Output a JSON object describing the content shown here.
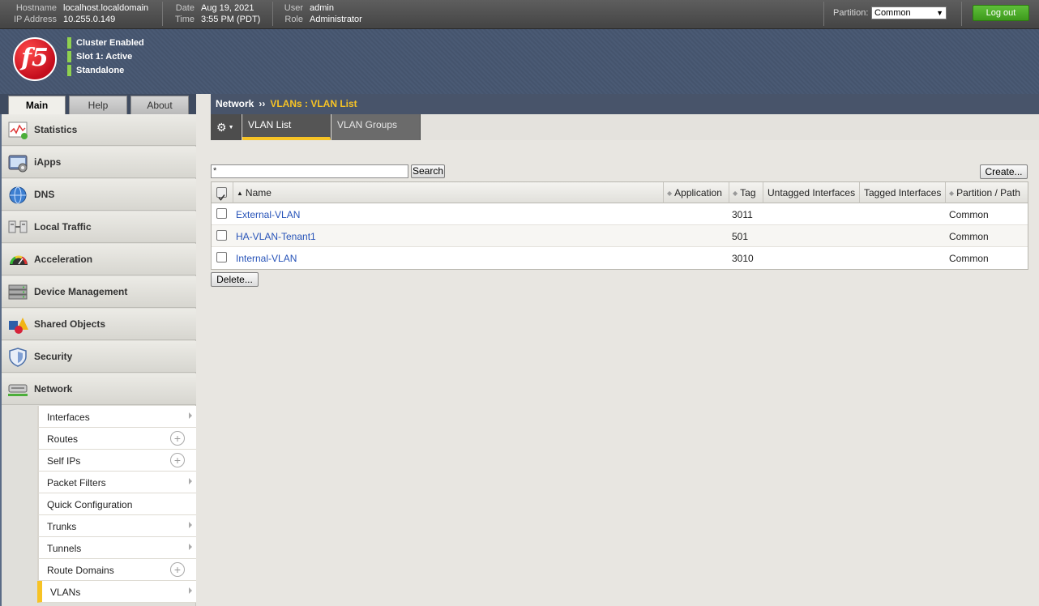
{
  "topbar": {
    "hostname_label": "Hostname",
    "hostname": "localhost.localdomain",
    "ip_label": "IP Address",
    "ip": "10.255.0.149",
    "date_label": "Date",
    "date": "Aug 19, 2021",
    "time_label": "Time",
    "time": "3:55 PM (PDT)",
    "user_label": "User",
    "user": "admin",
    "role_label": "Role",
    "role": "Administrator",
    "partition_label": "Partition:",
    "partition_value": "Common",
    "logout_label": "Log out"
  },
  "banner": {
    "logo_text": "f5",
    "status": [
      "Cluster Enabled",
      "Slot 1: Active",
      "Standalone"
    ]
  },
  "sidebar": {
    "tabs": [
      "Main",
      "Help",
      "About"
    ],
    "items": [
      {
        "label": "Statistics",
        "icon": "statistics-icon"
      },
      {
        "label": "iApps",
        "icon": "iapps-icon"
      },
      {
        "label": "DNS",
        "icon": "dns-globe-icon"
      },
      {
        "label": "Local Traffic",
        "icon": "local-traffic-icon"
      },
      {
        "label": "Acceleration",
        "icon": "acceleration-gauge-icon"
      },
      {
        "label": "Device Management",
        "icon": "device-management-icon"
      },
      {
        "label": "Shared Objects",
        "icon": "shared-objects-icon"
      },
      {
        "label": "Security",
        "icon": "security-shield-icon"
      },
      {
        "label": "Network",
        "icon": "network-icon"
      }
    ],
    "network_sub": [
      {
        "label": "Interfaces"
      },
      {
        "label": "Routes"
      },
      {
        "label": "Self IPs"
      },
      {
        "label": "Packet Filters"
      },
      {
        "label": "Quick Configuration"
      },
      {
        "label": "Trunks"
      },
      {
        "label": "Tunnels"
      },
      {
        "label": "Route Domains"
      },
      {
        "label": "VLANs"
      }
    ]
  },
  "breadcrumb": {
    "root": "Network",
    "sep": "››",
    "current": "VLANs : VLAN List"
  },
  "subnav": {
    "tabs": [
      "VLAN List",
      "VLAN Groups"
    ]
  },
  "search": {
    "value": "*",
    "button": "Search"
  },
  "create_button": "Create...",
  "delete_button": "Delete...",
  "table": {
    "columns": [
      "Name",
      "Application",
      "Tag",
      "Untagged Interfaces",
      "Tagged Interfaces",
      "Partition / Path"
    ],
    "rows": [
      {
        "name": "External-VLAN",
        "application": "",
        "tag": "3011",
        "untagged": "",
        "tagged": "",
        "partition": "Common"
      },
      {
        "name": "HA-VLAN-Tenant1",
        "application": "",
        "tag": "501",
        "untagged": "",
        "tagged": "",
        "partition": "Common"
      },
      {
        "name": "Internal-VLAN",
        "application": "",
        "tag": "3010",
        "untagged": "",
        "tagged": "",
        "partition": "Common"
      }
    ]
  },
  "colors": {
    "accent": "#f7c325",
    "logout": "#4caf2a",
    "link": "#2753b8",
    "banner": "#4a5a74"
  }
}
